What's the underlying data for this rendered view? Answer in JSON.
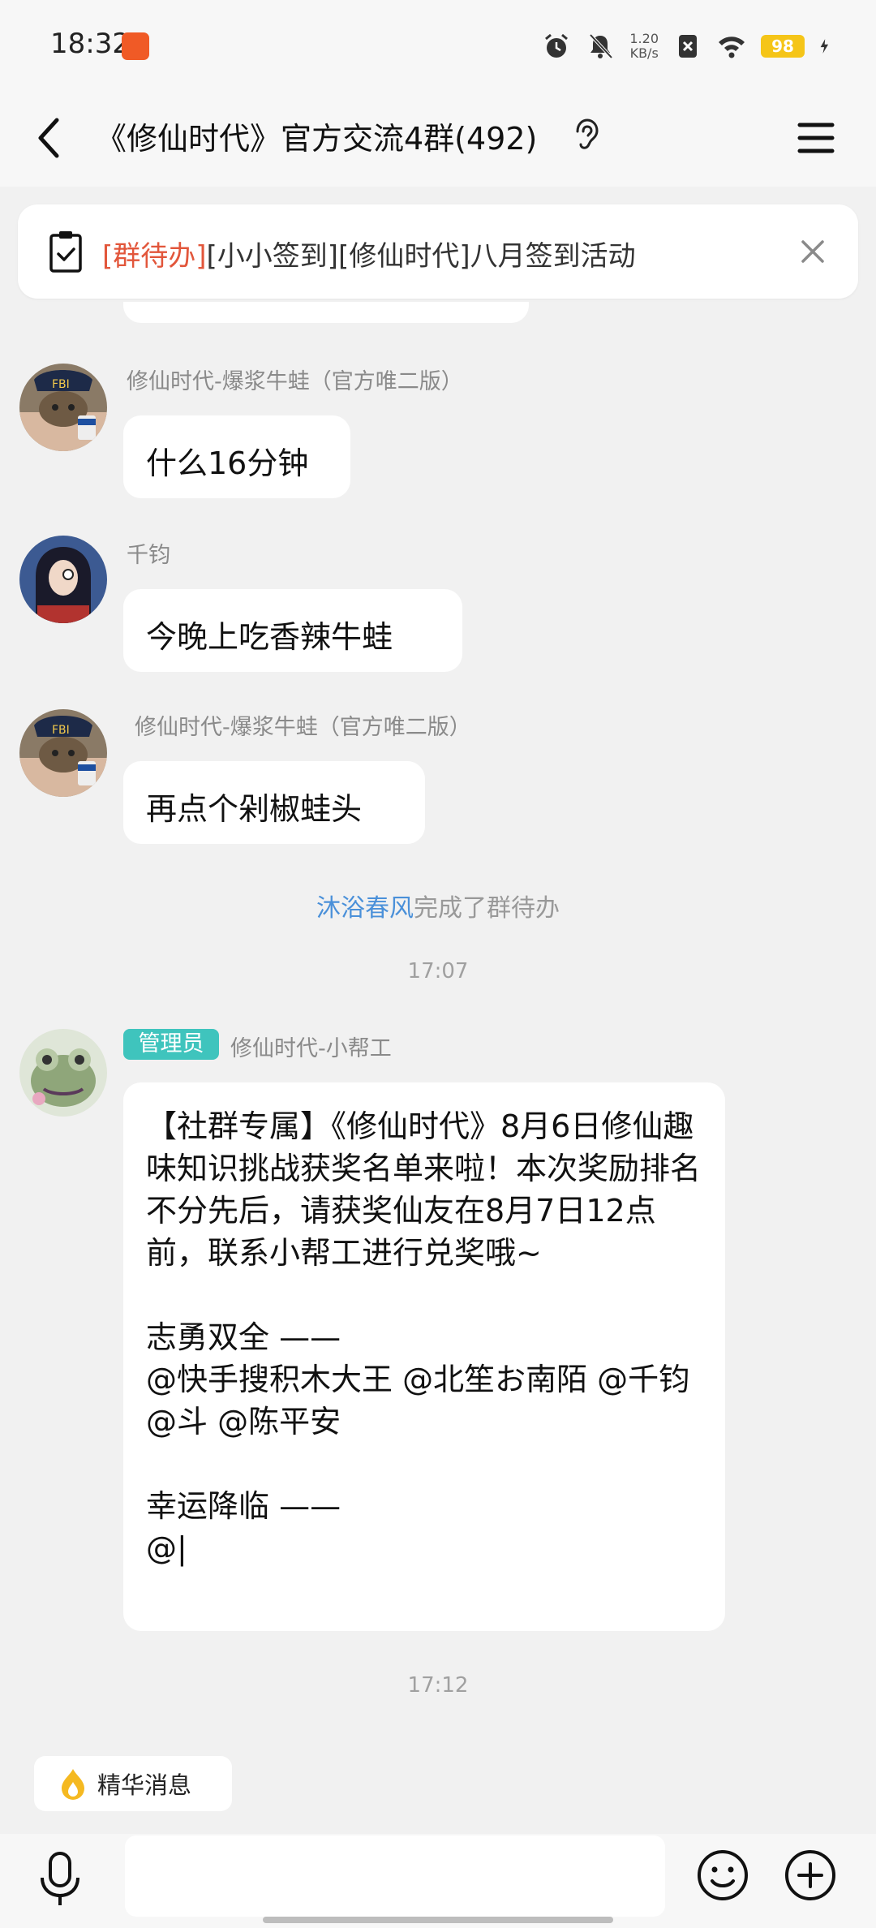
{
  "status_bar": {
    "time": "18:32",
    "net_speed_value": "1.20",
    "net_speed_unit": "KB/s",
    "battery": "98"
  },
  "header": {
    "title": "《修仙时代》官方交流4群(492)"
  },
  "notice": {
    "tag": "[群待办]",
    "text": "[小小签到][修仙时代]八月签到活动"
  },
  "messages": [
    {
      "sender": "修仙时代-爆浆牛蛙（官方唯二版）",
      "text": "什么16分钟"
    },
    {
      "sender": "千钧",
      "text": "今晚上吃香辣牛蛙"
    },
    {
      "sender": "修仙时代-爆浆牛蛙（官方唯二版）",
      "text": "再点个剁椒蛙头"
    }
  ],
  "system_message": {
    "name": "沐浴春风",
    "text": "完成了群待办"
  },
  "timestamps": [
    "17:07",
    "17:12"
  ],
  "admin_message": {
    "badge": "管理员",
    "sender": "修仙时代-小帮工",
    "text": "【社群专属】《修仙时代》8月6日修仙趣味知识挑战获奖名单来啦！本次奖励排名不分先后，请获奖仙友在8月7日12点前，联系小帮工进行兑奖哦~\n\n志勇双全 ——\n@快手搜积木大王 @北笙お南陌 @千钧 @斗 @陈平安\n\n幸运降临 ——\n@|"
  },
  "essence": {
    "label": "精华消息"
  },
  "input": {
    "placeholder": ""
  },
  "colors": {
    "notice_tag": "#e2563b",
    "system_name": "#4a90d9",
    "admin_badge": "#3fc4bd",
    "battery": "#f5c518"
  },
  "icons": [
    "back-icon",
    "ear-icon",
    "menu-icon",
    "clipboard-check-icon",
    "close-icon",
    "mic-icon",
    "emoji-icon",
    "plus-circle-icon",
    "flame-icon"
  ]
}
